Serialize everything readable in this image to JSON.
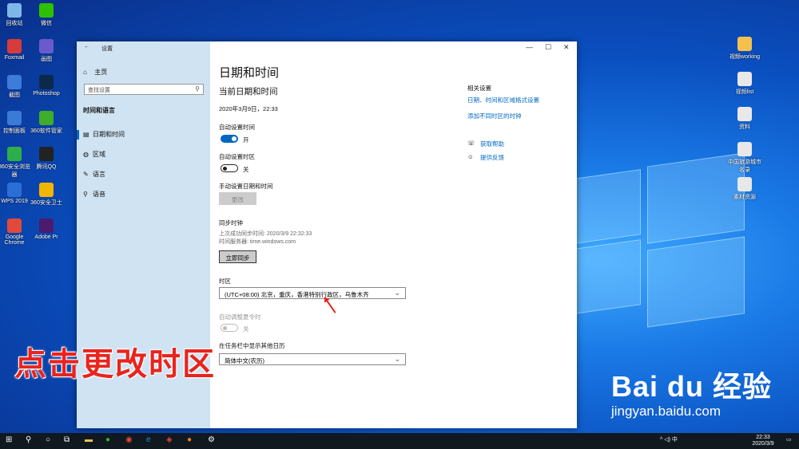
{
  "desktop": {
    "left_icons": [
      {
        "label": "回收站",
        "color": "#7fb8e8"
      },
      {
        "label": "微信",
        "color": "#2dc100"
      },
      {
        "label": "Foxmail",
        "color": "#d83b3b"
      },
      {
        "label": "画图",
        "color": "#6a5acd"
      },
      {
        "label": "截图",
        "color": "#3b7dd8"
      },
      {
        "label": "Photoshop",
        "color": "#0b2a4a"
      },
      {
        "label": "控制面板",
        "color": "#3a7bd5"
      },
      {
        "label": "360软件管家",
        "color": "#3fae2a"
      },
      {
        "label": "360安全浏览器",
        "color": "#2dae4a"
      },
      {
        "label": "腾讯QQ",
        "color": "#222222"
      },
      {
        "label": "WPS 2019",
        "color": "#2b6fd6"
      },
      {
        "label": "360安全卫士",
        "color": "#f2b600"
      },
      {
        "label": "Google Chrome",
        "color": "#e04a3b"
      },
      {
        "label": "Adobe Pr",
        "color": "#4b1b6e"
      }
    ],
    "right_icons": [
      {
        "label": "视频working",
        "color": "#f2c14e"
      },
      {
        "label": "视频list",
        "color": "#e8e8e8"
      },
      {
        "label": "资料",
        "color": "#e8e8e8"
      },
      {
        "label": "中国旅游城市名录",
        "color": "#e8e8e8"
      },
      {
        "label": "素材资源",
        "color": "#e8e8e8"
      }
    ]
  },
  "window": {
    "title": "设置",
    "back_icon": "←",
    "minimize": "—",
    "maximize": "☐",
    "close": "✕"
  },
  "sidebar": {
    "home": "主页",
    "search_placeholder": "查找设置",
    "section": "时间和语言",
    "items": [
      {
        "label": "日期和时间",
        "icon": "calendar-icon",
        "glyph": "▤",
        "active": true
      },
      {
        "label": "区域",
        "icon": "globe-icon",
        "glyph": "◍",
        "active": false
      },
      {
        "label": "语言",
        "icon": "language-icon",
        "glyph": "✎",
        "active": false
      },
      {
        "label": "语音",
        "icon": "microphone-icon",
        "glyph": "⚲",
        "active": false
      }
    ]
  },
  "main": {
    "page_title": "日期和时间",
    "section_current": "当前日期和时间",
    "current_datetime": "2020年3月9日，22:33",
    "auto_time_label": "自动设置时间",
    "auto_time_state": "开",
    "auto_zone_label": "自动设置时区",
    "auto_zone_state": "关",
    "manual_label": "手动设置日期和时间",
    "change_button": "更改",
    "sync_title": "同步时钟",
    "sync_last": "上次成功同步时间: 2020/3/9 22:32:33",
    "sync_server": "时间服务器: time.windows.com",
    "sync_button": "立即同步",
    "timezone_label": "时区",
    "timezone_value": "(UTC+08:00) 北京，重庆，香港特别行政区，乌鲁木齐",
    "dst_label": "自动调整夏令时",
    "dst_state": "关",
    "calendar_label": "在任务栏中显示其他日历",
    "calendar_value": "简体中文(农历)"
  },
  "related": {
    "title": "相关设置",
    "link1": "日期、时间和区域格式设置",
    "link2": "添加不同时区的时钟",
    "help": "获取帮助",
    "feedback": "提供反馈"
  },
  "taskbar": {
    "time": "22:33",
    "date": "2020/3/9",
    "tray_text": "^ ◁) 中"
  },
  "overlay": {
    "caption": "点击更改时区",
    "watermark_brand": "Bai du 经验",
    "watermark_url": "jingyan.baidu.com"
  },
  "colors": {
    "accent": "#0067c0",
    "caption": "#e8241e"
  }
}
